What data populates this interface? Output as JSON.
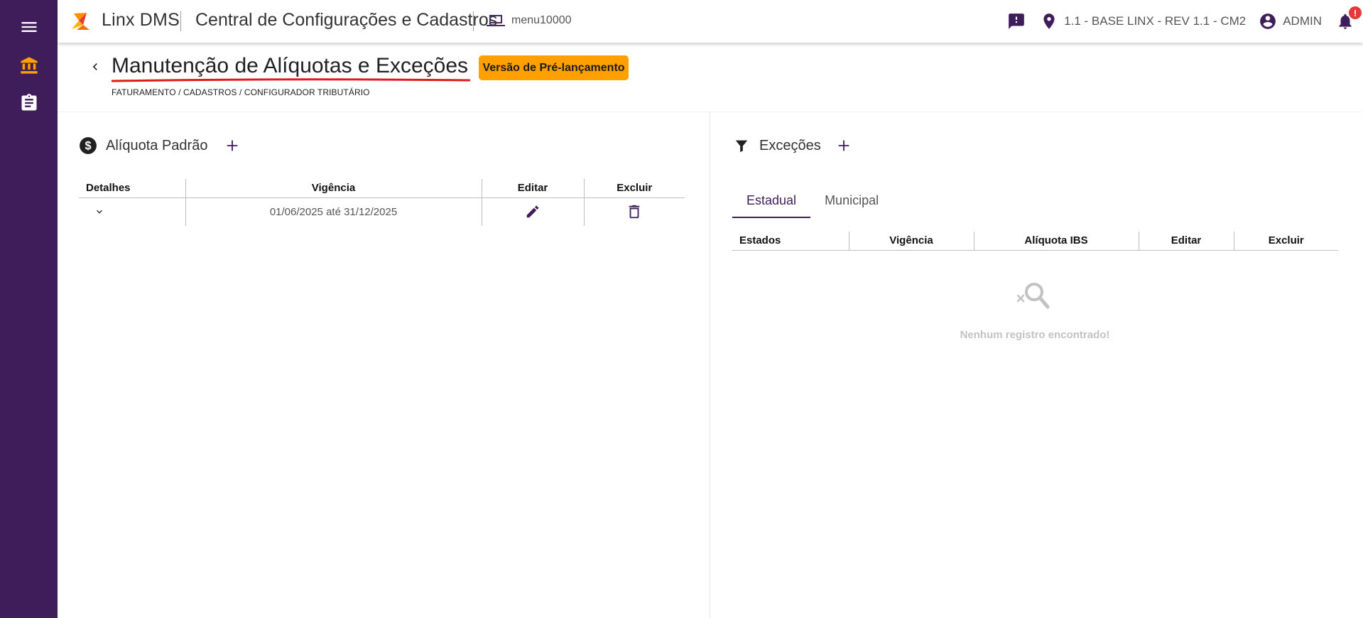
{
  "sidebar": {
    "items": [
      {
        "icon": "menu-icon"
      },
      {
        "icon": "bank-icon"
      },
      {
        "icon": "clipboard-icon"
      }
    ],
    "colors": {
      "background": "#3f1d5a",
      "accent": "#ffa000"
    }
  },
  "topbar": {
    "brand": "Linx DMS",
    "module": "Central de Configurações e Cadastros",
    "menu_code": "menu10000",
    "location": "1.1 - BASE LINX - REV 1.1 - CM2",
    "user": "ADMIN",
    "notifications_badge": "!"
  },
  "header": {
    "title": "Manutenção de Alíquotas e Exceções",
    "badge": "Versão de Pré-lançamento",
    "breadcrumb": "FATURAMENTO / CADASTROS / CONFIGURADOR TRIBUTÁRIO"
  },
  "left_panel": {
    "title": "Alíquota Padrão",
    "columns": [
      "Detalhes",
      "Vigência",
      "Editar",
      "Excluir"
    ],
    "rows": [
      {
        "vigencia": "01/06/2025 até 31/12/2025"
      }
    ]
  },
  "right_panel": {
    "title": "Exceções",
    "tabs": [
      {
        "label": "Estadual",
        "active": true
      },
      {
        "label": "Municipal",
        "active": false
      }
    ],
    "columns": [
      "Estados",
      "Vigência",
      "Alíquota IBS",
      "Editar",
      "Excluir"
    ],
    "empty_message": "Nenhum registro encontrado!"
  }
}
